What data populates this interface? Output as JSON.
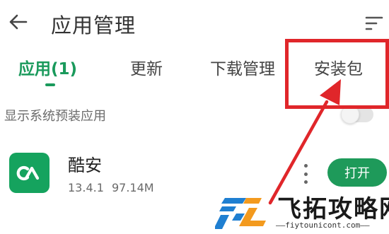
{
  "header": {
    "title": "应用管理",
    "back_icon": "arrow-left-icon",
    "sort_icon": "sort-icon"
  },
  "tabs": [
    {
      "label": "应用(1)",
      "active": true
    },
    {
      "label": "更新",
      "active": false
    },
    {
      "label": "下载管理",
      "active": false
    },
    {
      "label": "安装包",
      "active": false
    }
  ],
  "system_apps": {
    "label": "显示系统预装应用",
    "enabled": false
  },
  "apps": [
    {
      "name": "酷安",
      "version": "13.4.1",
      "size": "97.14M",
      "icon": "coolapk-logo-icon",
      "action_label": "打开"
    }
  ],
  "watermark": {
    "title": "飞拓攻略网",
    "url": "——fiytounicont.com——"
  },
  "colors": {
    "accent": "#1a9a5c",
    "highlight": "#e0262a",
    "watermark_blue": "#1f7fd1",
    "watermark_orange": "#f39a1e"
  }
}
